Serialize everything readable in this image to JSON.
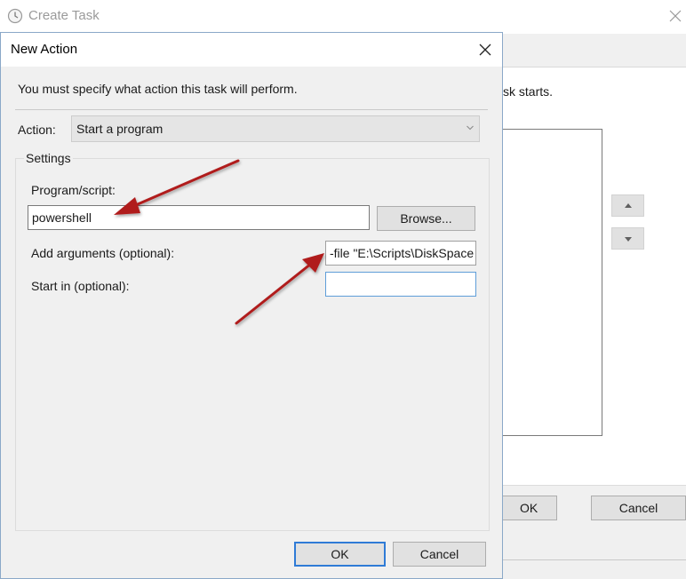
{
  "background_window": {
    "title": "Create Task",
    "title_icon": "clock-icon",
    "close_icon": "close-icon",
    "instruction_fragment": "sk starts.",
    "move_up_icon": "arrow-up-icon",
    "move_down_icon": "arrow-down-icon",
    "ok_label": "OK",
    "cancel_label": "Cancel"
  },
  "dialog": {
    "title": "New Action",
    "close_icon": "close-icon",
    "instruction": "You must specify what action this task will perform.",
    "action": {
      "label": "Action:",
      "selected": "Start a program",
      "dropdown_icon": "chevron-down-icon"
    },
    "settings": {
      "group_title": "Settings",
      "program_label": "Program/script:",
      "program_value": "powershell",
      "browse_label": "Browse...",
      "arguments_label": "Add arguments (optional):",
      "arguments_value": "-file \"E:\\Scripts\\DiskSpace",
      "start_in_label": "Start in (optional):",
      "start_in_value": ""
    },
    "ok_label": "OK",
    "cancel_label": "Cancel"
  },
  "annotations": {
    "arrow_color": "#b01d1d"
  },
  "colors": {
    "dialog_background": "#f0f0f0",
    "focus_border": "#2f7bd6"
  }
}
